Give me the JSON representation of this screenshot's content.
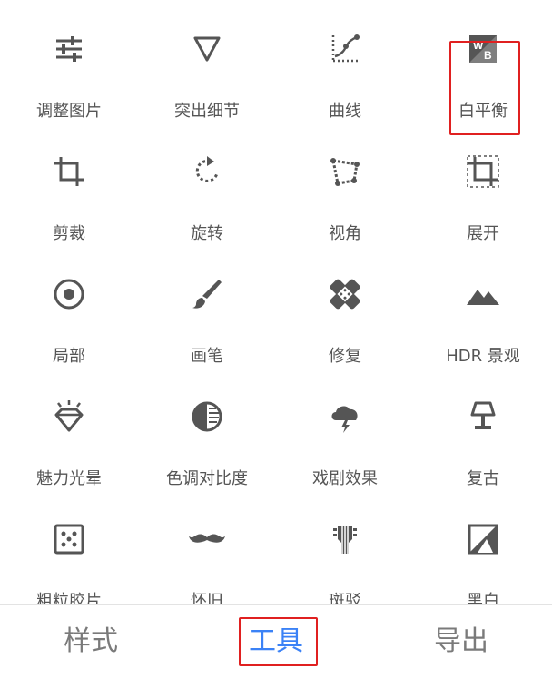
{
  "tools": [
    {
      "label": "调整图片",
      "icon": "tune-sliders-icon"
    },
    {
      "label": "突出细节",
      "icon": "triangle-down-icon"
    },
    {
      "label": "曲线",
      "icon": "curves-icon"
    },
    {
      "label": "白平衡",
      "icon": "white-balance-icon",
      "wb_letters": [
        "W",
        "B"
      ]
    },
    {
      "label": "剪裁",
      "icon": "crop-icon"
    },
    {
      "label": "旋转",
      "icon": "rotate-icon"
    },
    {
      "label": "视角",
      "icon": "perspective-icon"
    },
    {
      "label": "展开",
      "icon": "expand-icon"
    },
    {
      "label": "局部",
      "icon": "selective-target-icon"
    },
    {
      "label": "画笔",
      "icon": "brush-icon"
    },
    {
      "label": "修复",
      "icon": "healing-bandage-icon"
    },
    {
      "label": "HDR 景观",
      "icon": "mountain-icon"
    },
    {
      "label": "魅力光晕",
      "icon": "glamour-glow-diamond-icon"
    },
    {
      "label": "色调对比度",
      "icon": "tonal-contrast-icon"
    },
    {
      "label": "戏剧效果",
      "icon": "storm-cloud-icon"
    },
    {
      "label": "复古",
      "icon": "lamp-icon"
    },
    {
      "label": "粗粒胶片",
      "icon": "grainy-film-dice-icon"
    },
    {
      "label": "怀旧",
      "icon": "mustache-icon"
    },
    {
      "label": "斑驳",
      "icon": "grunge-guitar-icon"
    },
    {
      "label": "黑白",
      "icon": "black-white-photo-icon"
    }
  ],
  "bottom_tabs": [
    {
      "label": "样式"
    },
    {
      "label": "工具",
      "active": true
    },
    {
      "label": "导出"
    }
  ],
  "colors": {
    "icon": "#555555",
    "label": "#555555",
    "active_tab": "#3b82f6",
    "highlight_border": "#e02020"
  }
}
